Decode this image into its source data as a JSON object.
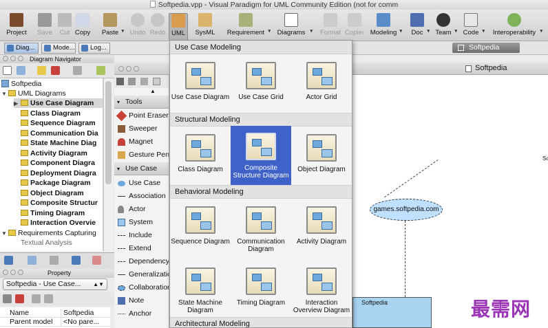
{
  "window": {
    "title": "Softpedia.vpp - Visual Paradigm for UML Community Edition (not for comm"
  },
  "toolbar": {
    "project": "Project",
    "save": "Save",
    "cut": "Cut",
    "copy": "Copy",
    "paste": "Paste",
    "undo": "Undo",
    "redo": "Redo",
    "uml": "UML",
    "sysml": "SysML",
    "requirement": "Requirement",
    "diagrams": "Diagrams",
    "format": "Format",
    "copier": "Copier",
    "modeling": "Modeling",
    "doc": "Doc",
    "team": "Team",
    "code": "Code",
    "interoperability": "Interoperability"
  },
  "panel_tabs": {
    "diagram": "Diag...",
    "model": "Mode...",
    "log": "Log..."
  },
  "project_tab": "Softpedia",
  "navigator": {
    "title": "Diagram Navigator",
    "root": "Softpedia",
    "uml_folder": "UML Diagrams",
    "items": [
      "Use Case Diagram",
      "Class Diagram",
      "Sequence Diagram",
      "Communication Dia",
      "State Machine Diag",
      "Activity Diagram",
      "Component Diagra",
      "Deployment Diagra",
      "Package Diagram",
      "Object Diagram",
      "Composite Structur",
      "Timing Diagram",
      "Interaction Overvie"
    ],
    "req_folder": "Requirements Capturing",
    "partial": "Textual Analysis"
  },
  "property": {
    "title": "Property",
    "selected": "Softpedia - Use Case...",
    "rows": [
      {
        "k": "Name",
        "v": "Softpedia"
      },
      {
        "k": "Parent model",
        "v": "<No pare..."
      }
    ]
  },
  "editor": {
    "tab": "Softpedia"
  },
  "palette": {
    "tools_header": "Tools",
    "tools": [
      "Point Eraser",
      "Sweeper",
      "Magnet",
      "Gesture Pen"
    ],
    "usecase_header": "Use Case",
    "usecase_items": [
      "Use Case",
      "Association",
      "Actor",
      "System",
      "Include",
      "Extend",
      "Dependency",
      "Generalization",
      "Collaboration",
      "Note",
      "Anchor"
    ]
  },
  "menu": {
    "sections": [
      {
        "title": "Use Case Modeling",
        "items": [
          "Use Case Diagram",
          "Use Case Grid",
          "Actor Grid"
        ]
      },
      {
        "title": "Structural Modeling",
        "items": [
          "Class Diagram",
          "Composite Structure Diagram",
          "Object Diagram"
        ]
      },
      {
        "title": "Behavioral Modeling",
        "items": [
          "Sequence Diagram",
          "Communication Diagram",
          "Activity Diagram",
          "State Machine Diagram",
          "Timing Diagram",
          "Interaction Overview Diagram"
        ]
      },
      {
        "title": "Architectural Modeling",
        "items": []
      }
    ]
  },
  "canvas": {
    "usecase": "games.softpedia.com",
    "box": "Softpedia",
    "edge_text": "So"
  },
  "watermark": "最需网",
  "colors": {
    "menu_selection": "#3f62c8",
    "usecase_fill": "#bfe0ff",
    "box_fill": "#a8d4f2",
    "watermark": "#9b35b5"
  }
}
